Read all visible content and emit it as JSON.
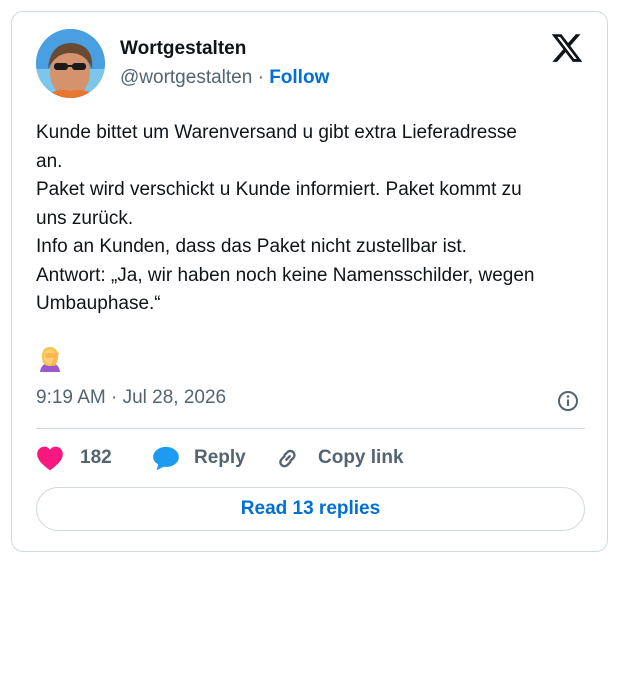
{
  "author": {
    "name": "Wortgestalten",
    "handle": "@wortgestalten",
    "separator": "·",
    "follow_label": "Follow"
  },
  "tweet": {
    "lines": [
      "Kunde bittet um Warenversand u gibt extra Lieferadresse",
      "an.",
      "Paket wird verschickt u Kunde informiert. Paket kommt zu",
      "uns zurück.",
      "Info an Kunden, dass das Paket nicht zustellbar ist.",
      "Antwort: „Ja, wir haben noch keine Namensschilder, wegen",
      "Umbauphase.“"
    ],
    "emoji_icon": "facepalm-woman-emoji",
    "timestamp": "9:19 AM · Jul 28, 2026"
  },
  "actions": {
    "like_count": "182",
    "reply_label": "Reply",
    "copy_link_label": "Copy link"
  },
  "read_replies_label": "Read 13 replies",
  "colors": {
    "accent": "#006fd6",
    "like": "#f91880",
    "reply_icon": "#1d9bf0",
    "muted_text": "#536471",
    "border": "#cfd9de"
  }
}
